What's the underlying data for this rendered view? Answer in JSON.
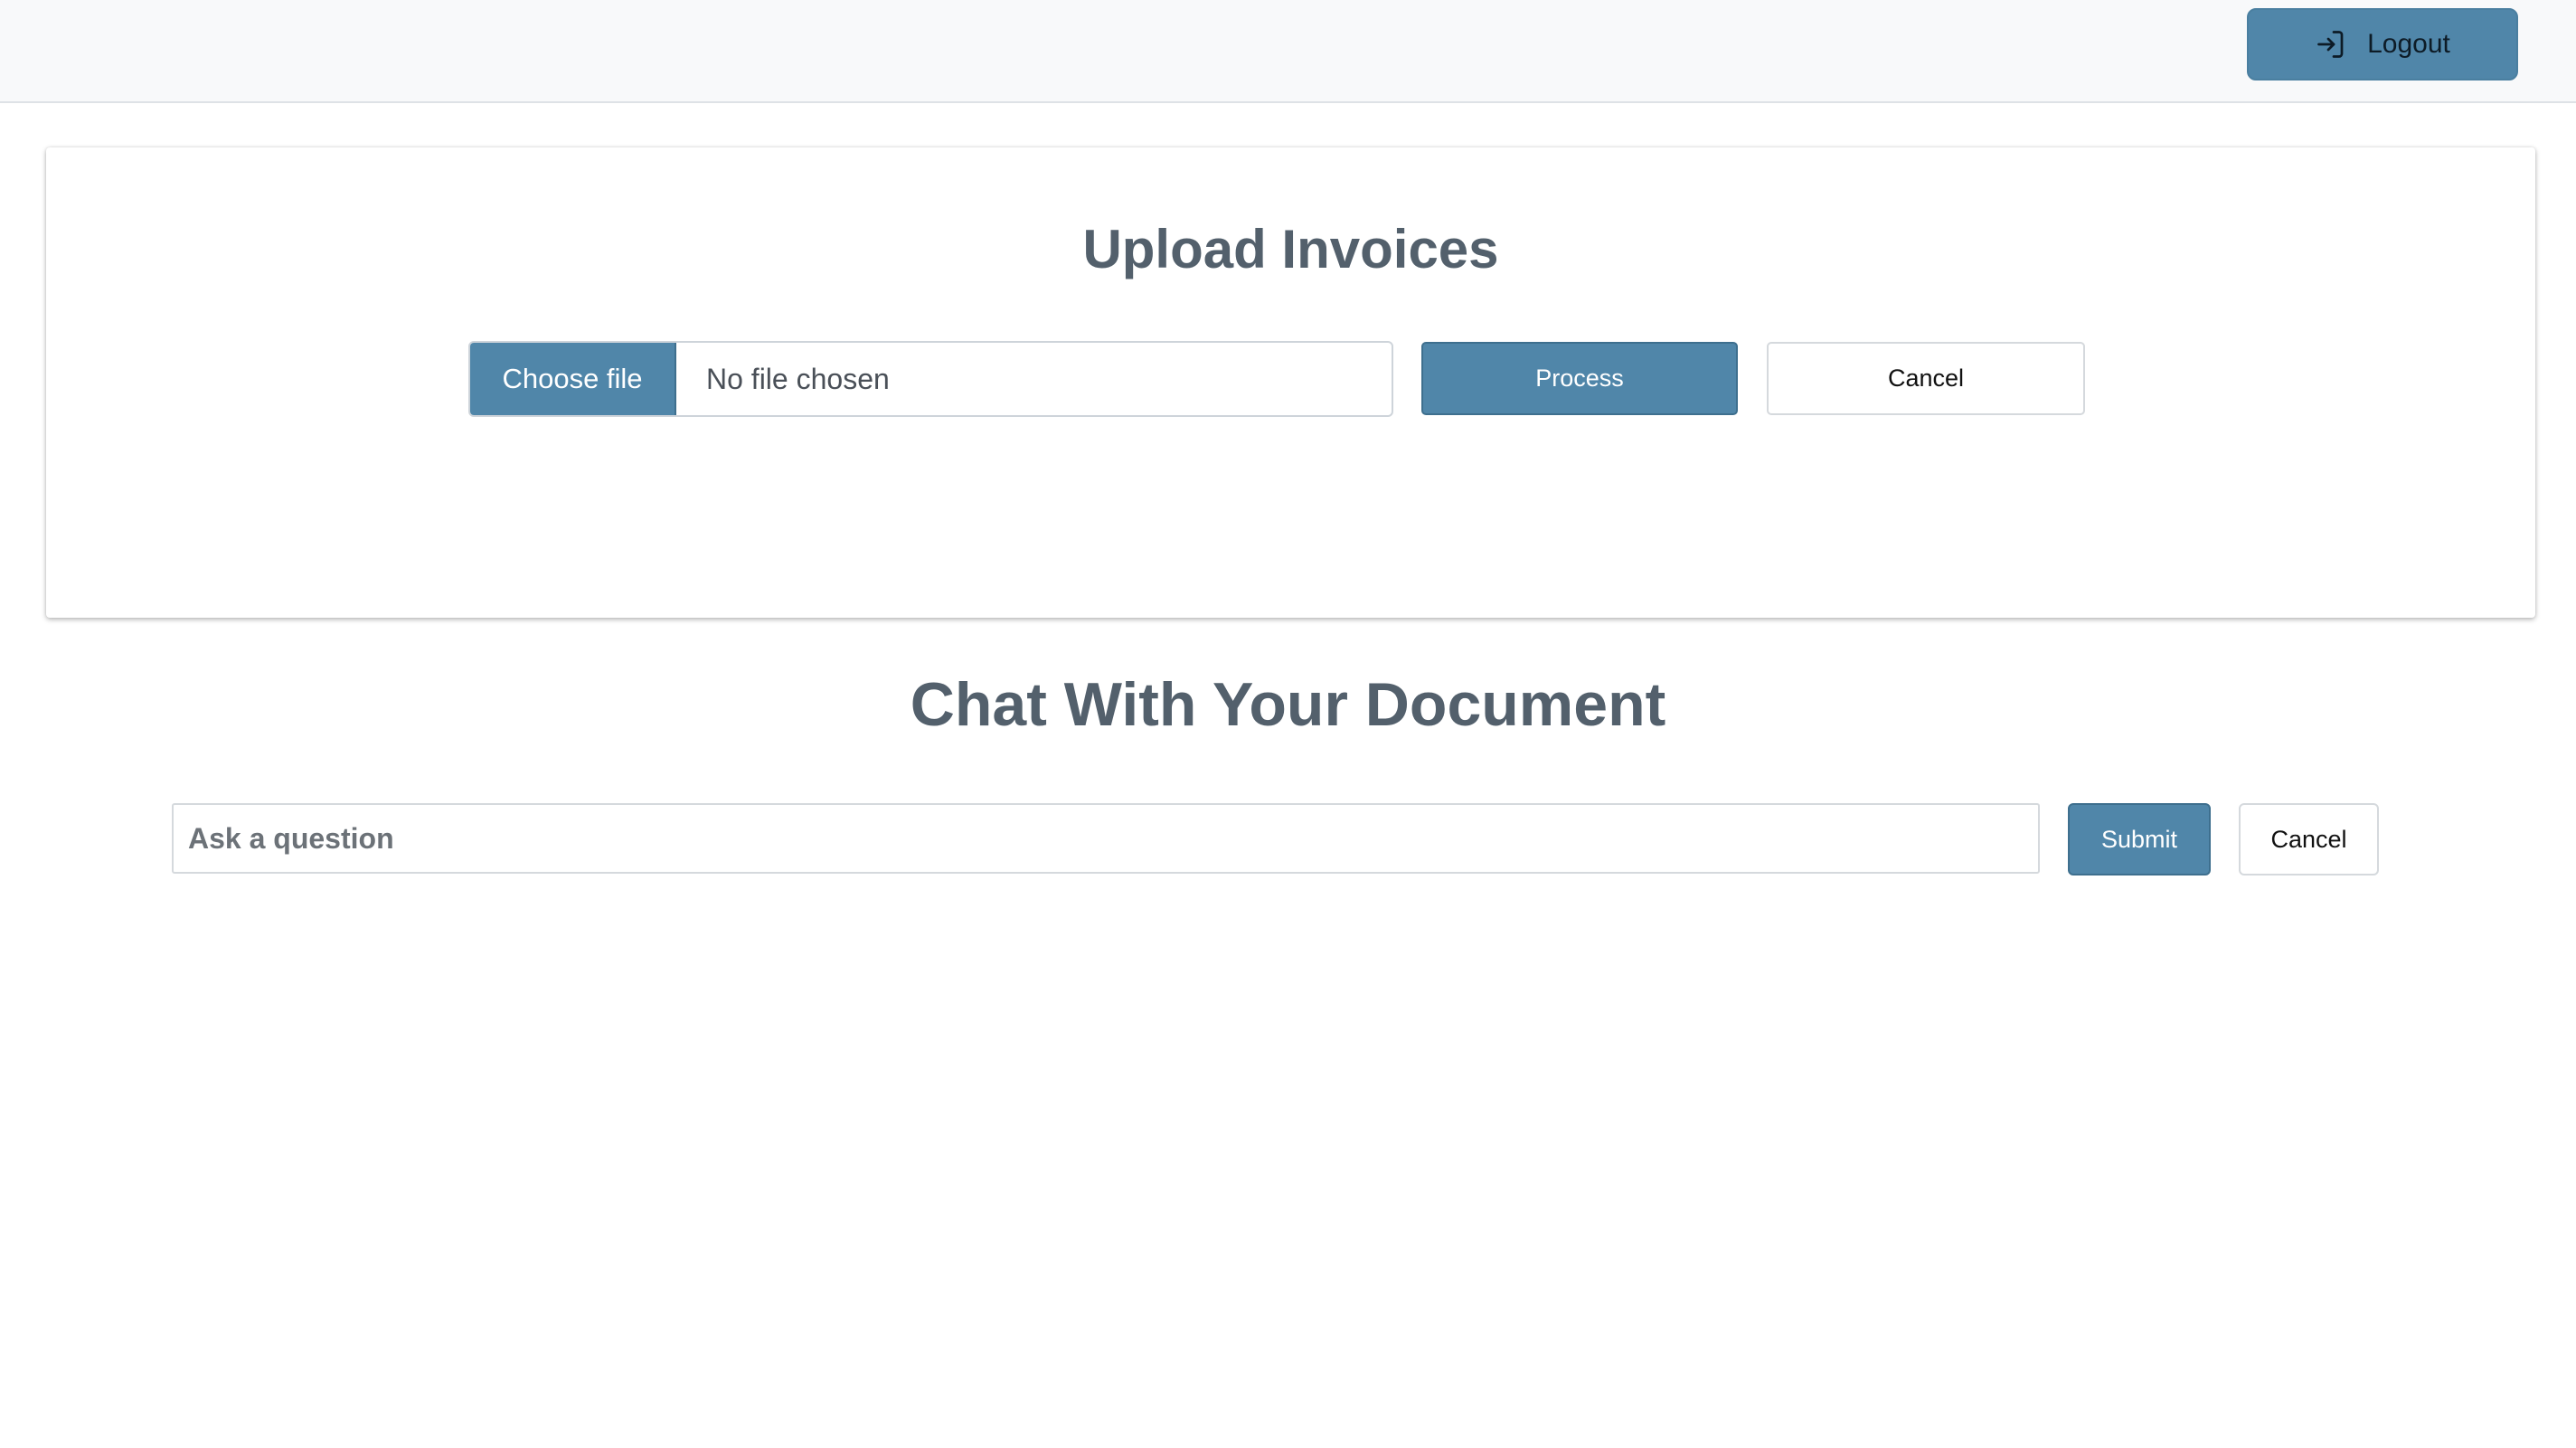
{
  "header": {
    "logout_label": "Logout",
    "logout_icon": "sign-in-arrow-icon"
  },
  "upload": {
    "title": "Upload Invoices",
    "choose_file_label": "Choose file",
    "file_status": "No file chosen",
    "process_label": "Process",
    "cancel_label": "Cancel"
  },
  "chat": {
    "title": "Chat With Your Document",
    "question_placeholder": "Ask a question",
    "question_value": "",
    "submit_label": "Submit",
    "cancel_label": "Cancel"
  },
  "colors": {
    "accent": "#5086a9",
    "heading": "#53606c",
    "topbar_bg": "#f8f9fa"
  }
}
